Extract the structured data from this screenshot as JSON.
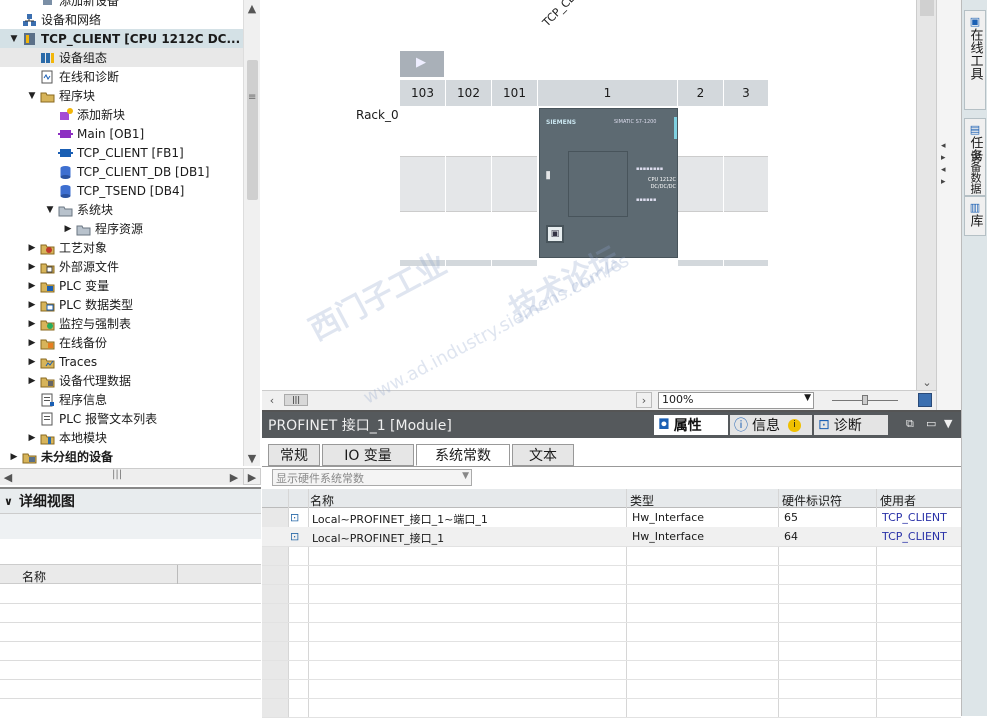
{
  "tree": {
    "items": [
      {
        "label": "添加新设备",
        "indent": 40,
        "arrow": "",
        "icon": "add"
      },
      {
        "label": "设备和网络",
        "indent": 22,
        "arrow": "",
        "icon": "network"
      },
      {
        "label": "TCP_CLIENT [CPU 1212C DC...",
        "indent": 22,
        "arrow": "▼",
        "icon": "cpu",
        "style": "hdr"
      },
      {
        "label": "设备组态",
        "indent": 40,
        "arrow": "",
        "icon": "config",
        "style": "sel"
      },
      {
        "label": "在线和诊断",
        "indent": 40,
        "arrow": "",
        "icon": "diag"
      },
      {
        "label": "程序块",
        "indent": 40,
        "arrow": "▼",
        "icon": "folder"
      },
      {
        "label": "添加新块",
        "indent": 58,
        "arrow": "",
        "icon": "addblock"
      },
      {
        "label": "Main [OB1]",
        "indent": 58,
        "arrow": "",
        "icon": "ob"
      },
      {
        "label": "TCP_CLIENT [FB1]",
        "indent": 58,
        "arrow": "",
        "icon": "fb"
      },
      {
        "label": "TCP_CLIENT_DB [DB1]",
        "indent": 58,
        "arrow": "",
        "icon": "db"
      },
      {
        "label": "TCP_TSEND [DB4]",
        "indent": 58,
        "arrow": "",
        "icon": "db"
      },
      {
        "label": "系统块",
        "indent": 58,
        "arrow": "▼",
        "icon": "sysfolder"
      },
      {
        "label": "程序资源",
        "indent": 76,
        "arrow": "▶",
        "icon": "sysfolder"
      },
      {
        "label": "工艺对象",
        "indent": 40,
        "arrow": "▶",
        "icon": "tech"
      },
      {
        "label": "外部源文件",
        "indent": 40,
        "arrow": "▶",
        "icon": "ext"
      },
      {
        "label": "PLC 变量",
        "indent": 40,
        "arrow": "▶",
        "icon": "tag"
      },
      {
        "label": "PLC 数据类型",
        "indent": 40,
        "arrow": "▶",
        "icon": "type"
      },
      {
        "label": "监控与强制表",
        "indent": 40,
        "arrow": "▶",
        "icon": "watch"
      },
      {
        "label": "在线备份",
        "indent": 40,
        "arrow": "▶",
        "icon": "backup"
      },
      {
        "label": "Traces",
        "indent": 40,
        "arrow": "▶",
        "icon": "trace"
      },
      {
        "label": "设备代理数据",
        "indent": 40,
        "arrow": "▶",
        "icon": "proxy"
      },
      {
        "label": "程序信息",
        "indent": 40,
        "arrow": "",
        "icon": "info"
      },
      {
        "label": "PLC 报警文本列表",
        "indent": 40,
        "arrow": "",
        "icon": "doc"
      },
      {
        "label": "本地模块",
        "indent": 40,
        "arrow": "▶",
        "icon": "local"
      },
      {
        "label": "未分组的设备",
        "indent": 22,
        "arrow": "▶",
        "icon": "ungroup",
        "style": "bold"
      }
    ]
  },
  "details_view": {
    "title": "详细视图",
    "column_name": "名称"
  },
  "device_view": {
    "station_label": "TCP_CLIENT",
    "rack_label": "Rack_0",
    "slots": [
      "103",
      "102",
      "101",
      "1",
      "2",
      "3"
    ],
    "cpu_brand": "SIEMENS",
    "cpu_model": "SIMATIC S7-1200",
    "cpu_type_line1": "CPU 1212C",
    "cpu_type_line2": "DC/DC/DC",
    "zoom": "100%"
  },
  "properties": {
    "title": "PROFINET 接口_1 [Module]",
    "tabs_right": [
      "属性",
      "信息",
      "诊断"
    ],
    "tabs": [
      "常规",
      "IO 变量",
      "系统常数",
      "文本"
    ],
    "active_tab": "系统常数",
    "filter_placeholder": "显示硬件系统常数",
    "columns": [
      "名称",
      "类型",
      "硬件标识符",
      "使用者"
    ],
    "rows": [
      {
        "name": "Local~PROFINET_接口_1~端口_1",
        "type": "Hw_Interface",
        "hwid": "65",
        "user": "TCP_CLIENT"
      },
      {
        "name": "Local~PROFINET_接口_1",
        "type": "Hw_Interface",
        "hwid": "64",
        "user": "TCP_CLIENT"
      }
    ]
  },
  "taskcards": [
    "在线工具",
    "任务",
    "设备数据",
    "库"
  ],
  "watermark": [
    "西门子工业",
    "技术论坛",
    "www.ad.industry.siemens.com/cs"
  ],
  "colors": {
    "accent": "#1a5fb4",
    "link": "#2a32a8",
    "selected": "#e8e8e8",
    "header_dark": "#55595c"
  }
}
